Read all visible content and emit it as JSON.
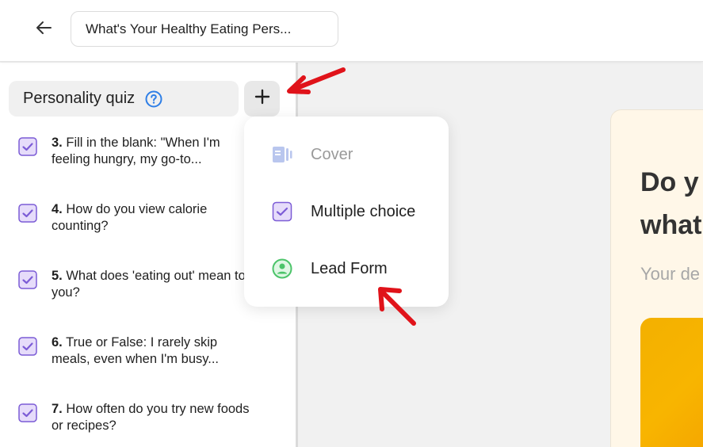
{
  "header": {
    "quiz_title": "What's Your Healthy Eating Pers..."
  },
  "sidebar": {
    "quiz_type_label": "Personality quiz",
    "questions": [
      {
        "number": "3.",
        "text": "Fill in the blank: \"When I'm feeling hungry, my go-to..."
      },
      {
        "number": "4.",
        "text": "How do you view calorie counting?"
      },
      {
        "number": "5.",
        "text": "What does 'eating out' mean to you?"
      },
      {
        "number": "6.",
        "text": "True or False: I rarely skip meals, even when I'm busy..."
      },
      {
        "number": "7.",
        "text": "How often do you try new foods or recipes?"
      }
    ]
  },
  "add_menu": {
    "items": [
      {
        "label": "Cover",
        "icon": "cover-icon",
        "disabled": true
      },
      {
        "label": "Multiple choice",
        "icon": "multiple-choice-icon",
        "disabled": false
      },
      {
        "label": "Lead Form",
        "icon": "lead-form-icon",
        "disabled": false
      }
    ]
  },
  "preview": {
    "heading_line1": "Do y",
    "heading_line2": "what",
    "subtitle": "Your de"
  },
  "colors": {
    "accent_purple": "#7c5cd6",
    "check_bg": "#e6dcfa",
    "lead_green": "#4cc46a",
    "help_blue": "#2f7fe6",
    "annotation_red": "#e0131a"
  }
}
